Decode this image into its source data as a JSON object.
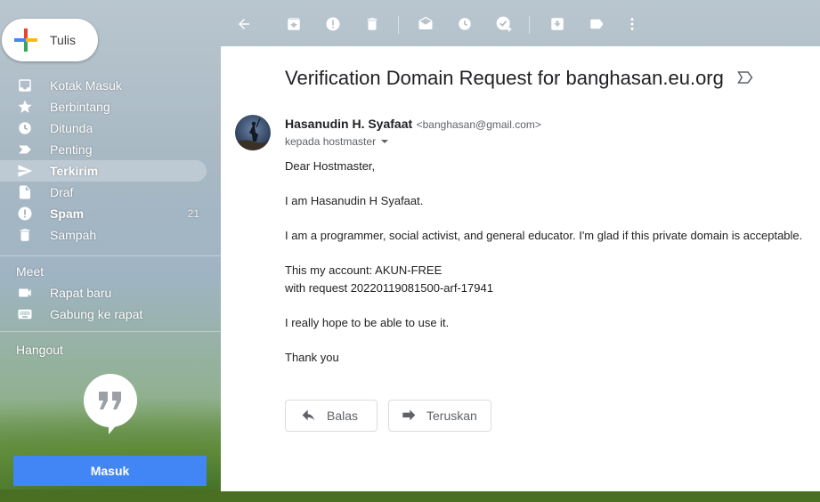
{
  "compose": {
    "label": "Tulis"
  },
  "nav": {
    "items": [
      {
        "label": "Kotak Masuk",
        "icon": "inbox-icon"
      },
      {
        "label": "Berbintang",
        "icon": "star-icon"
      },
      {
        "label": "Ditunda",
        "icon": "clock-icon"
      },
      {
        "label": "Penting",
        "icon": "important-icon"
      },
      {
        "label": "Terkirim",
        "icon": "send-icon",
        "active": true
      },
      {
        "label": "Draf",
        "icon": "draft-icon"
      },
      {
        "label": "Spam",
        "icon": "spam-icon",
        "count": "21"
      },
      {
        "label": "Sampah",
        "icon": "trash-icon"
      }
    ]
  },
  "meet": {
    "title": "Meet",
    "new_meeting": "Rapat baru",
    "join_meeting": "Gabung ke rapat"
  },
  "hangout": {
    "title": "Hangout",
    "signin_label": "Masuk"
  },
  "email": {
    "subject": "Verification Domain Request for banghasan.eu.org",
    "sender_name": "Hasanudin H. Syafaat",
    "sender_email": "<banghasan@gmail.com>",
    "recipient": "kepada hostmaster",
    "body": {
      "greeting": "Dear Hostmaster,",
      "intro": "I am Hasanudin H Syafaat.",
      "about": "I am a programmer, social activist, and general educator. I'm glad if this private domain is acceptable.",
      "account": "This my account: AKUN-FREE",
      "request": "with request 20220119081500-arf-17941",
      "hope": "I really hope to be able to use it.",
      "closing": "Thank you"
    }
  },
  "actions": {
    "reply": "Balas",
    "forward": "Teruskan"
  },
  "colors": {
    "accent": "#4285f4",
    "compose_red": "#ea4335",
    "compose_green": "#34a853",
    "compose_blue": "#4285f4",
    "compose_yellow": "#fbbc05"
  }
}
